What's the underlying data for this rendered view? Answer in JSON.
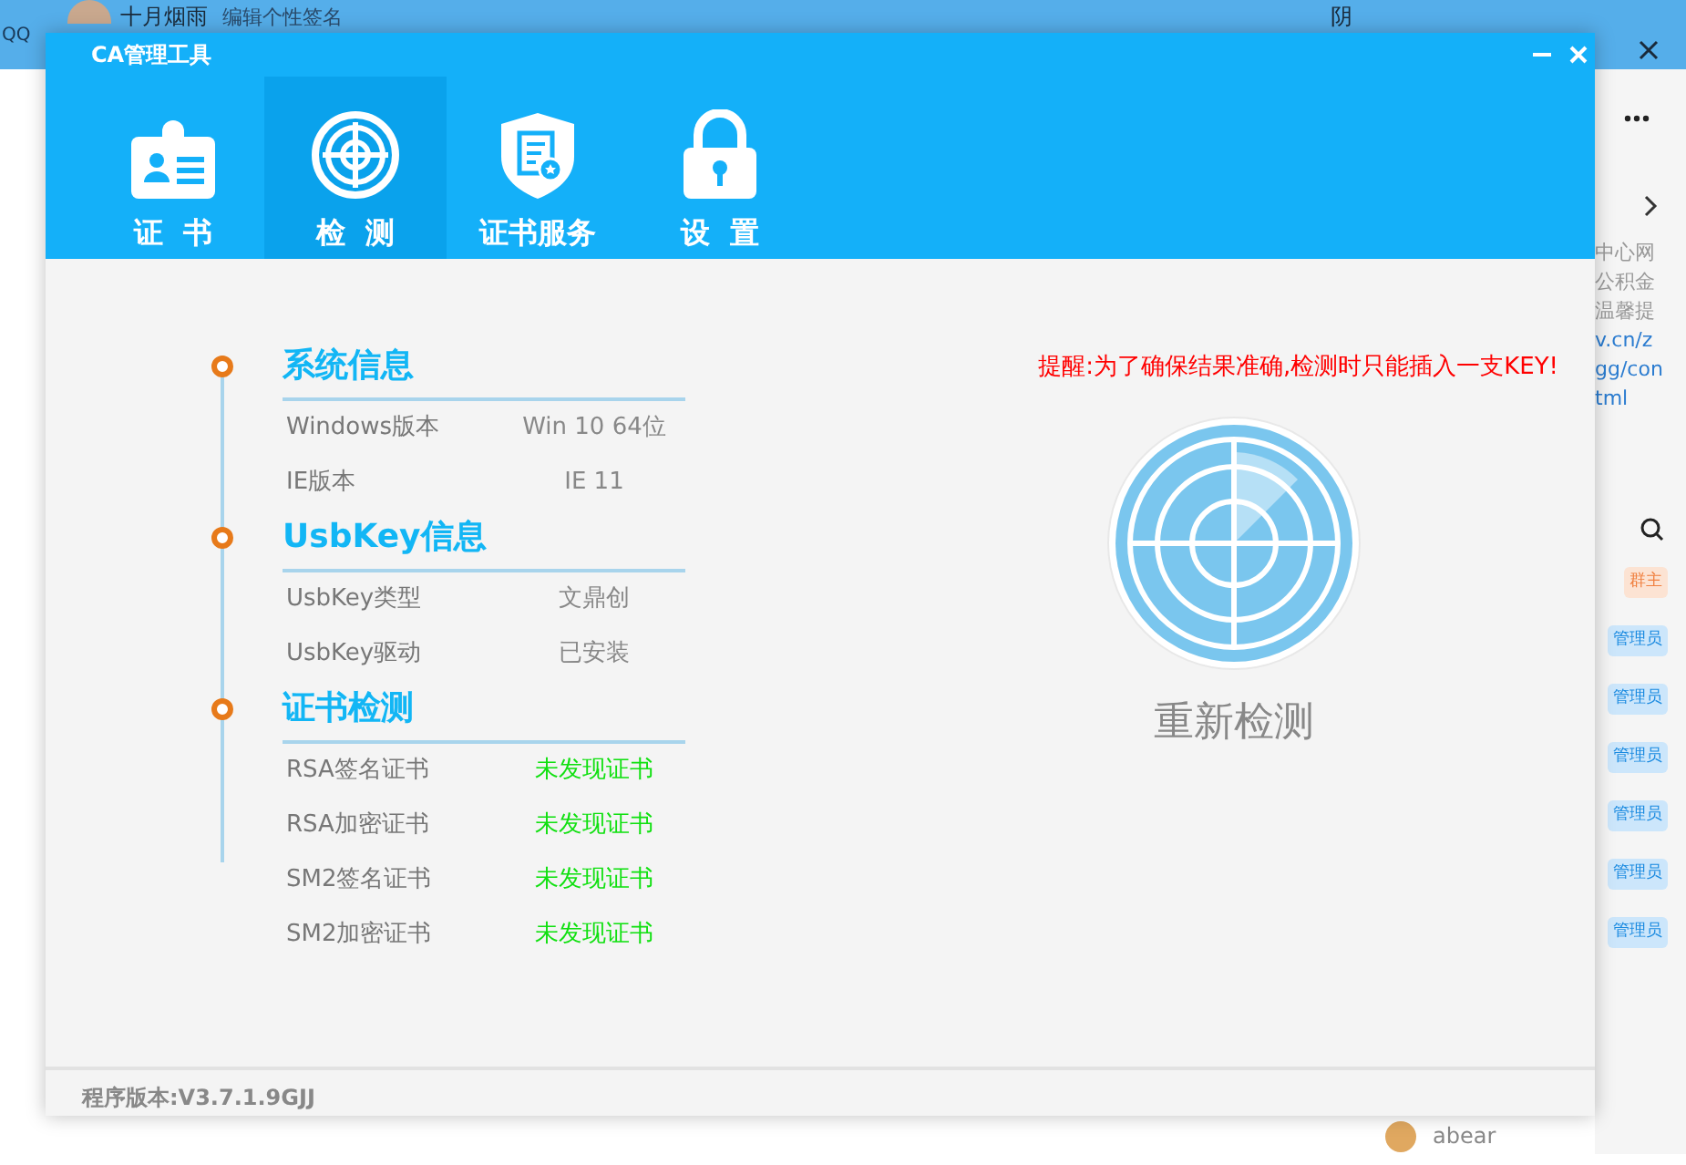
{
  "background_app": {
    "app_name": "QQ",
    "user_name": "十月烟雨",
    "signature": "编辑个性签名",
    "weather": "阴",
    "notice_lines": [
      "中心网",
      "公积金",
      "温馨提",
      "v.cn/z",
      "gg/con",
      "tml"
    ],
    "member_badges": [
      {
        "label": "群主",
        "kind": "owner"
      },
      {
        "label": "管理员",
        "kind": "admin"
      },
      {
        "label": "管理员",
        "kind": "admin"
      },
      {
        "label": "管理员",
        "kind": "admin"
      },
      {
        "label": "管理员",
        "kind": "admin"
      },
      {
        "label": "管理员",
        "kind": "admin"
      },
      {
        "label": "管理员",
        "kind": "admin"
      }
    ],
    "member_name": "abear"
  },
  "window": {
    "title": "CA管理工具"
  },
  "tabs": [
    {
      "label": "证  书",
      "selected": false
    },
    {
      "label": "检  测",
      "selected": true
    },
    {
      "label": "证书服务",
      "selected": false
    },
    {
      "label": "设  置",
      "selected": false
    }
  ],
  "sections": [
    {
      "title": "系统信息",
      "rows": [
        {
          "label": "Windows版本",
          "value": "Win 10 64位",
          "kind": "info"
        },
        {
          "label": "IE版本",
          "value": "IE 11",
          "kind": "info"
        }
      ]
    },
    {
      "title": "UsbKey信息",
      "rows": [
        {
          "label": "UsbKey类型",
          "value": "文鼎创",
          "kind": "info"
        },
        {
          "label": "UsbKey驱动",
          "value": "已安装",
          "kind": "info"
        }
      ]
    },
    {
      "title": "证书检测",
      "rows": [
        {
          "label": "RSA签名证书",
          "value": "未发现证书",
          "kind": "result"
        },
        {
          "label": "RSA加密证书",
          "value": "未发现证书",
          "kind": "result"
        },
        {
          "label": "SM2签名证书",
          "value": "未发现证书",
          "kind": "result"
        },
        {
          "label": "SM2加密证书",
          "value": "未发现证书",
          "kind": "result"
        }
      ]
    }
  ],
  "reminder": "提醒:为了确保结果准确,检测时只能插入一支KEY!",
  "action": "重新检测",
  "version": "程序版本:V3.7.1.9GJJ"
}
